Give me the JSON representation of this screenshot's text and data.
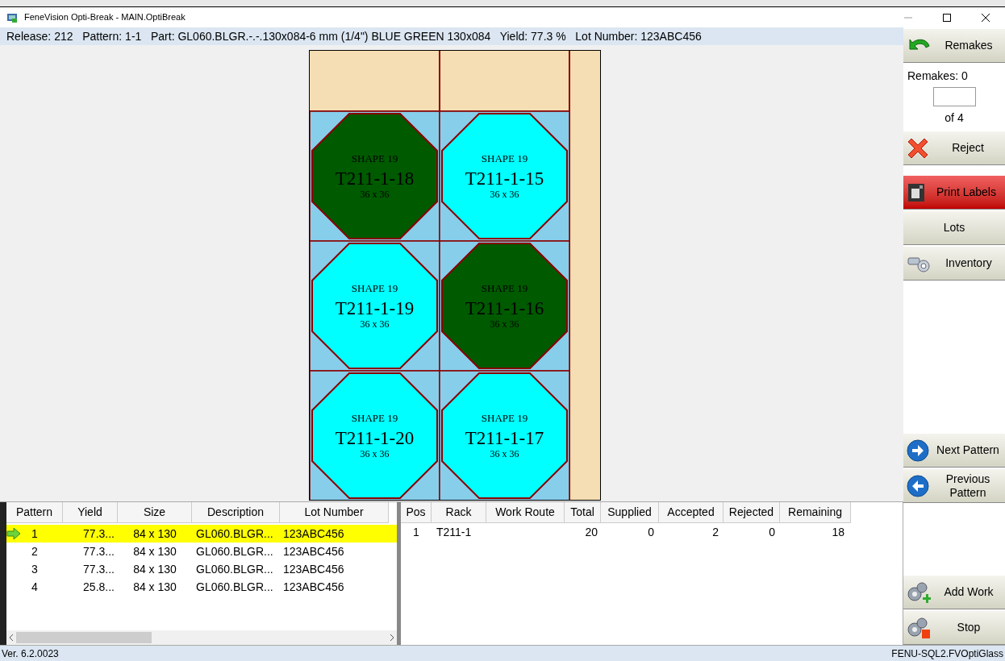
{
  "window": {
    "title": "FeneVision Opti-Break - MAIN.OptiBreak"
  },
  "info_bar": "Release: 212   Pattern: 1-1   Part: GL060.BLGR.-.-.130x084-6 mm (1/4\") BLUE GREEN 130x084   Yield: 77.3 %   Lot Number: 123ABC456",
  "sheet": {
    "pieces": [
      {
        "shape": "SHAPE 19",
        "label": "T211-1-18",
        "size": "36 x 36",
        "color": "#005a00"
      },
      {
        "shape": "SHAPE 19",
        "label": "T211-1-15",
        "size": "36 x 36",
        "color": "#00ffff"
      },
      {
        "shape": "SHAPE 19",
        "label": "T211-1-19",
        "size": "36 x 36",
        "color": "#00ffff"
      },
      {
        "shape": "SHAPE 19",
        "label": "T211-1-16",
        "size": "36 x 36",
        "color": "#005a00"
      },
      {
        "shape": "SHAPE 19",
        "label": "T211-1-20",
        "size": "36 x 36",
        "color": "#00ffff"
      },
      {
        "shape": "SHAPE 19",
        "label": "T211-1-17",
        "size": "36 x 36",
        "color": "#00ffff"
      }
    ]
  },
  "patterns_table": {
    "columns": [
      "Pattern",
      "Yield",
      "Size",
      "Description",
      "Lot Number"
    ],
    "rows": [
      {
        "selected": true,
        "cells": [
          "1",
          "77.3...",
          "84 x 130",
          "GL060.BLGR...",
          "123ABC456"
        ]
      },
      {
        "selected": false,
        "cells": [
          "2",
          "77.3...",
          "84 x 130",
          "GL060.BLGR...",
          "123ABC456"
        ]
      },
      {
        "selected": false,
        "cells": [
          "3",
          "77.3...",
          "84 x 130",
          "GL060.BLGR...",
          "123ABC456"
        ]
      },
      {
        "selected": false,
        "cells": [
          "4",
          "25.8...",
          "84 x 130",
          "GL060.BLGR...",
          "123ABC456"
        ]
      }
    ]
  },
  "racks_table": {
    "columns": [
      "Pos",
      "Rack",
      "Work Route",
      "Total",
      "Supplied",
      "Accepted",
      "Rejected",
      "Remaining"
    ],
    "rows": [
      {
        "cells": [
          "1",
          "T211-1",
          "",
          "20",
          "0",
          "2",
          "0",
          "18"
        ]
      }
    ]
  },
  "sidebar": {
    "remakes_button": "Remakes",
    "remakes_count": "Remakes: 0",
    "of_text": "of 4",
    "buttons": [
      {
        "kind": "reject",
        "label": "Reject"
      },
      {
        "kind": "print",
        "label": "Print Labels"
      },
      {
        "kind": "plain",
        "label": "Lots"
      },
      {
        "kind": "inventory",
        "label": "Inventory"
      }
    ],
    "nav_buttons": [
      {
        "kind": "next",
        "label": "Next Pattern"
      },
      {
        "kind": "previous",
        "label": "Previous Pattern"
      }
    ],
    "bottom_buttons": [
      {
        "kind": "add",
        "label": "Add Work"
      },
      {
        "kind": "stop",
        "label": "Stop"
      }
    ]
  },
  "status_bar": {
    "version": "Ver. 6.2.0023",
    "server": "FENU-SQL2.FVOptiGlass"
  }
}
